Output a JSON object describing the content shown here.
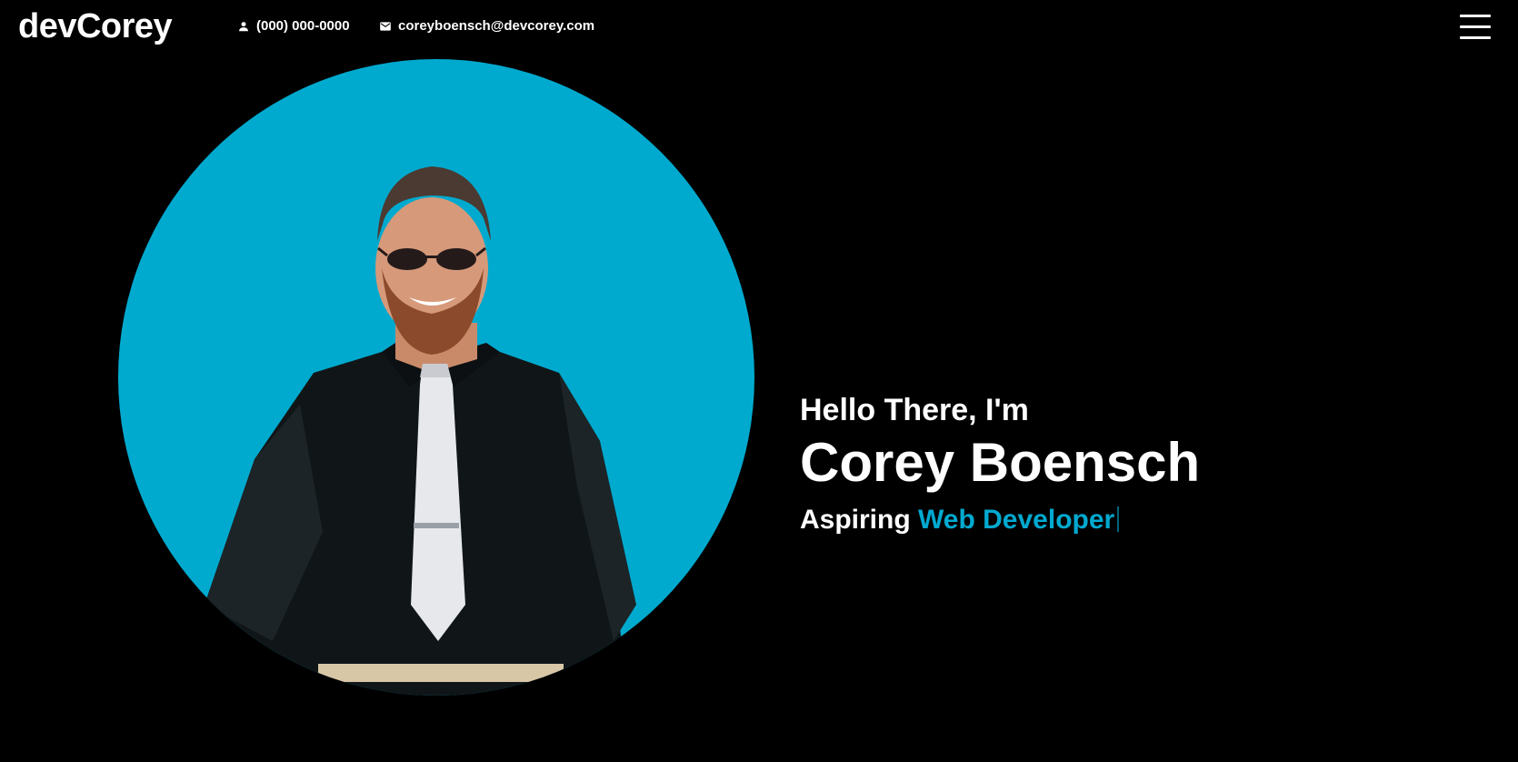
{
  "header": {
    "brand": "devCorey",
    "phone": "(000) 000-0000",
    "email": "coreyboensch@devcorey.com",
    "phone_icon": "person-icon",
    "email_icon": "envelope-icon",
    "menu_icon": "hamburger-menu-icon"
  },
  "hero": {
    "greeting": "Hello There, I'm",
    "name": "Corey Boensch",
    "tagline_prefix": "Aspiring",
    "tagline_accent": "Web Developer"
  },
  "colors": {
    "background": "#000000",
    "accent": "#00a9d0",
    "text": "#ffffff"
  }
}
